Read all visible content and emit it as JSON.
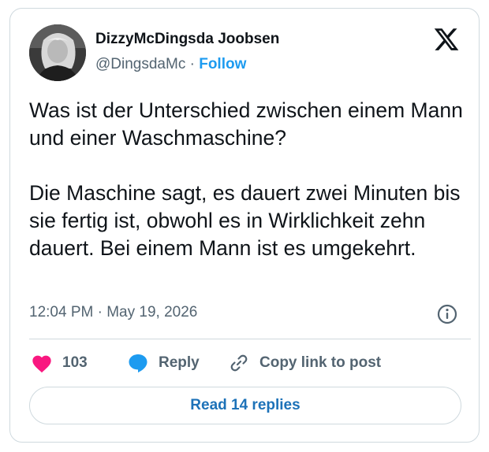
{
  "author": {
    "name": "DizzyMcDingsda Joobsen",
    "handle": "@DingsdaMc",
    "separator": "·",
    "follow_label": "Follow"
  },
  "tweet": {
    "text": "Was ist der Unterschied zwischen einem Mann und einer Waschmaschine?\n\nDie Maschine sagt, es dauert zwei Minuten bis sie fertig ist, obwohl es in Wirklichkeit zehn dauert. Bei einem Mann ist es umgekehrt.",
    "timestamp": "12:04 PM · May 19, 2026"
  },
  "actions": {
    "like_count": "103",
    "reply_label": "Reply",
    "copy_label": "Copy link to post"
  },
  "footer": {
    "read_replies_label": "Read 14 replies"
  },
  "icons": {
    "brand": "x-logo-icon",
    "info": "info-icon",
    "like": "heart-icon",
    "reply": "speech-bubble-icon",
    "copy": "link-icon"
  },
  "colors": {
    "like": "#f91880",
    "reply": "#1d9bf0",
    "follow": "#1d9bf0",
    "read_button_text": "#1d72b8",
    "secondary_text": "#536471",
    "border": "#cfd9de"
  }
}
